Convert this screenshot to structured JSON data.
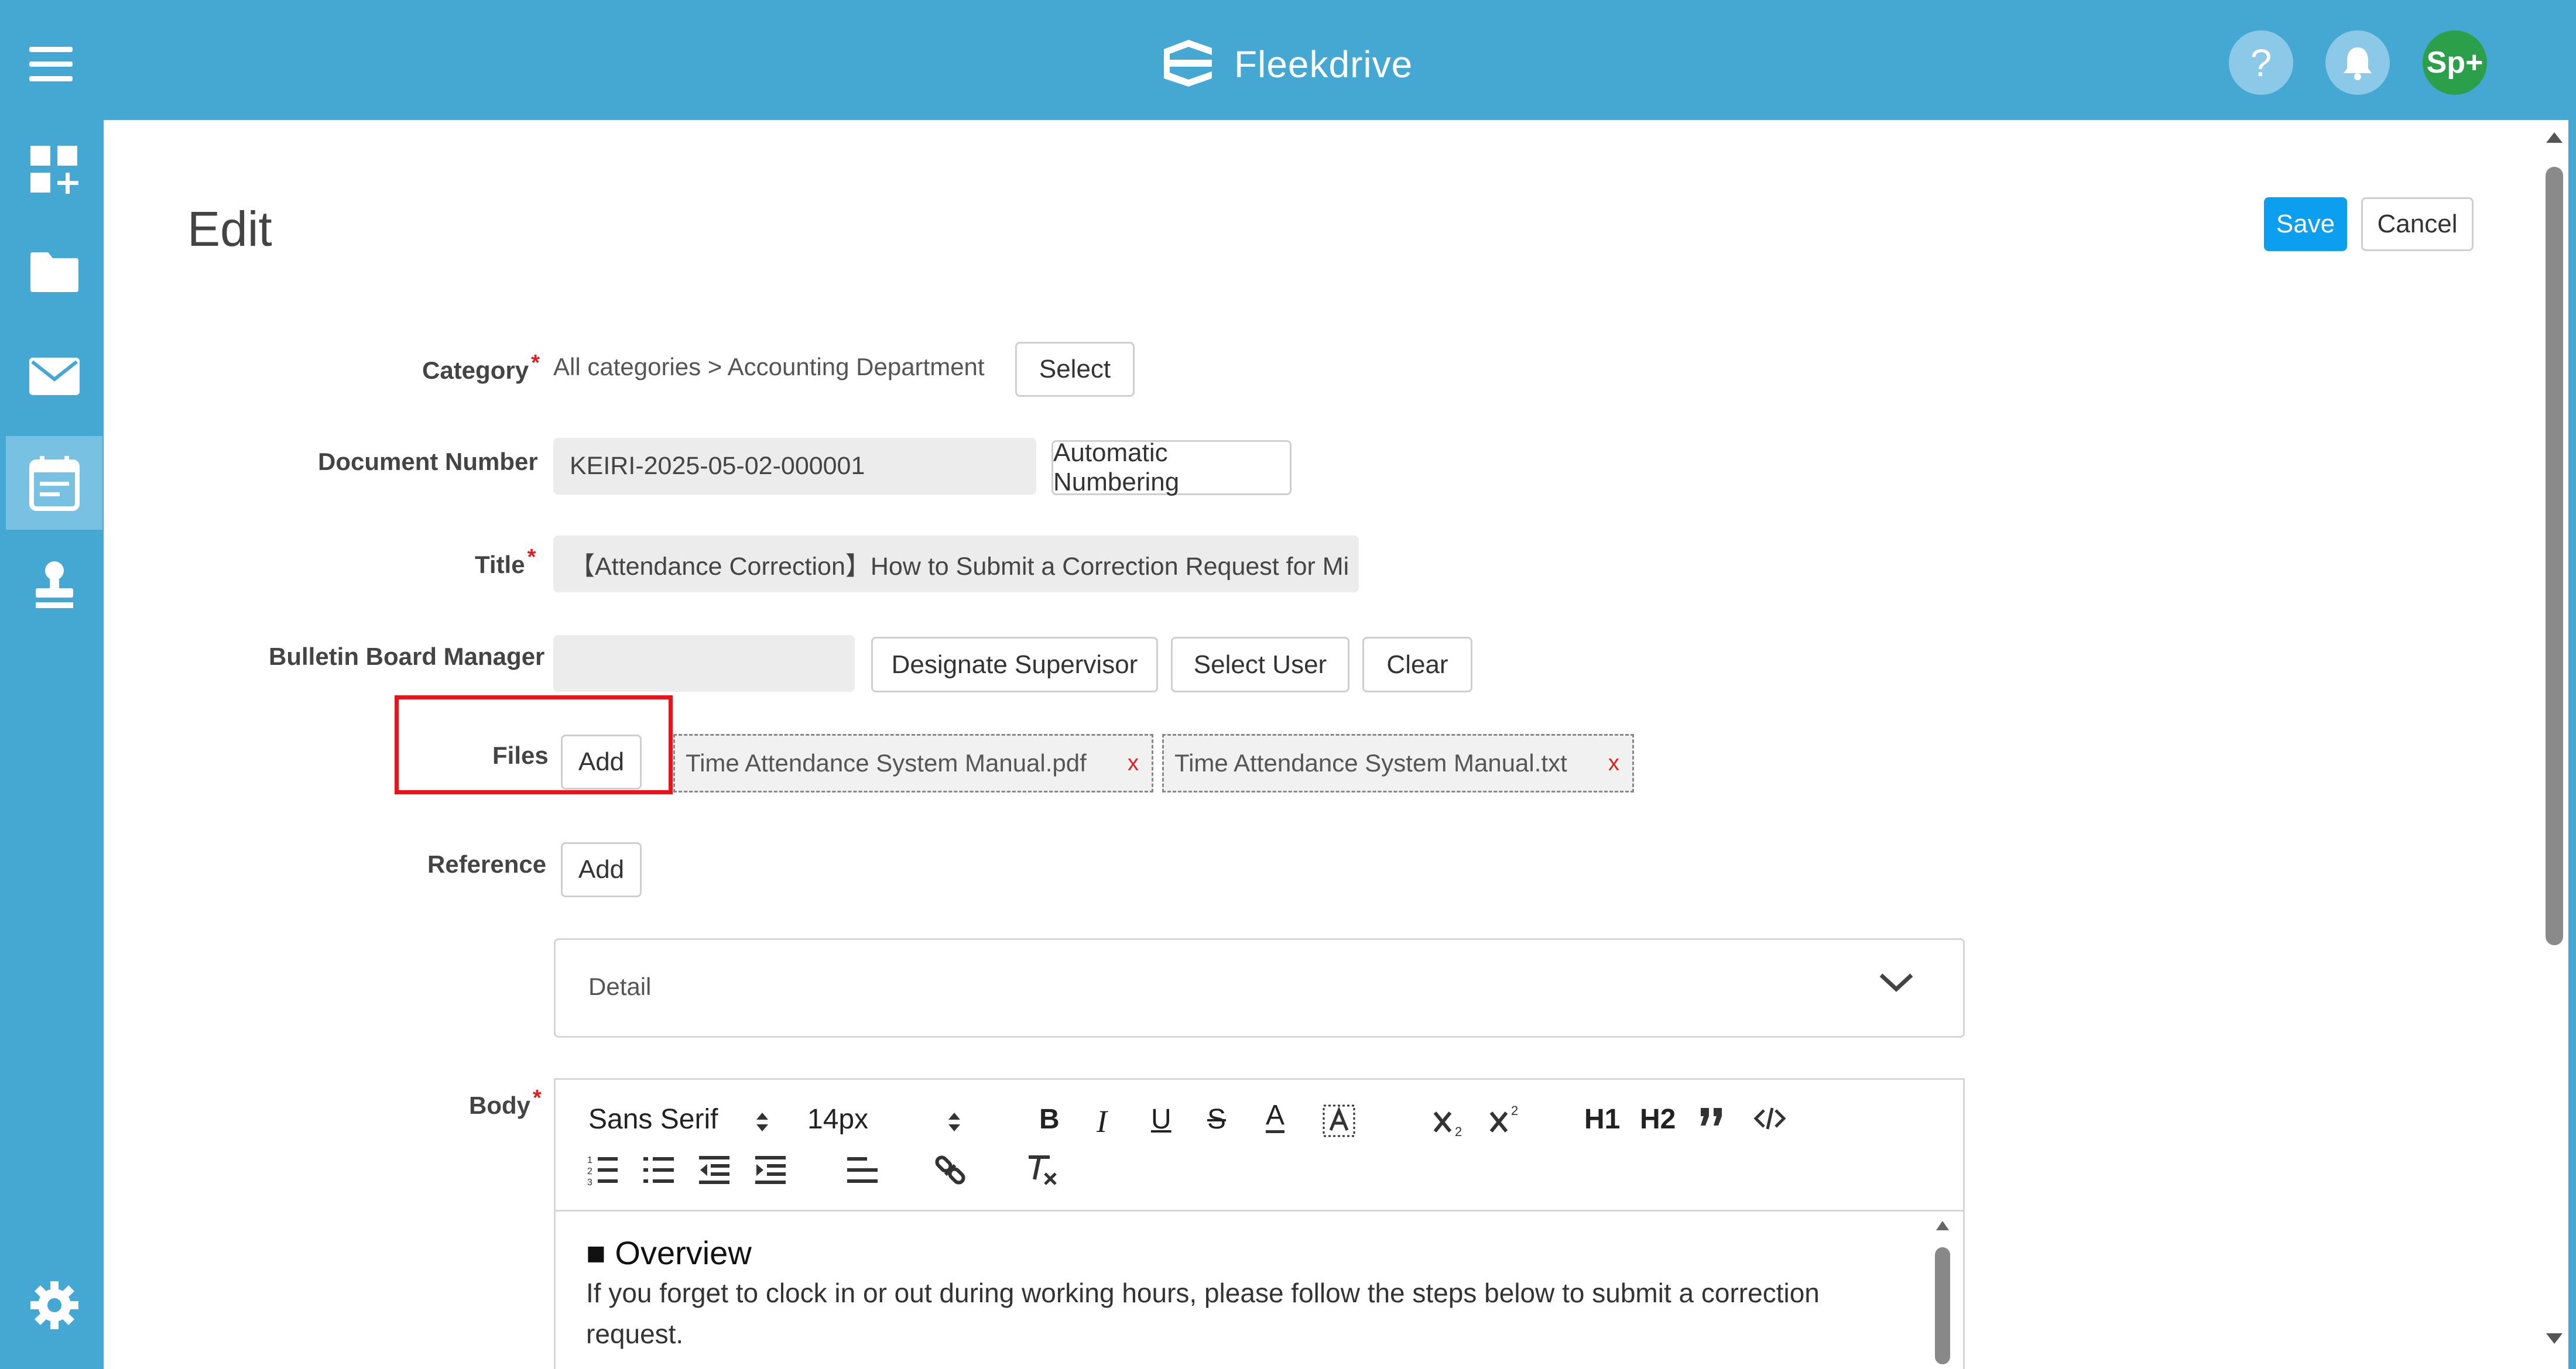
{
  "header": {
    "logo_text": "Fleekdrive",
    "help_label": "?",
    "avatar_label": "Sp+"
  },
  "sidebar": {
    "items": [
      {
        "icon": "dashboard-add-icon"
      },
      {
        "icon": "folder-icon"
      },
      {
        "icon": "mail-icon"
      },
      {
        "icon": "calendar-board-icon",
        "active": true
      },
      {
        "icon": "stamp-icon"
      }
    ],
    "bottom_icon": "gear-icon"
  },
  "page": {
    "title": "Edit",
    "save_label": "Save",
    "cancel_label": "Cancel"
  },
  "form": {
    "category": {
      "label": "Category",
      "required_mark": "*",
      "value": "All categories > Accounting Department",
      "button": "Select"
    },
    "document_number": {
      "label": "Document Number",
      "value": "KEIRI-2025-05-02-000001",
      "button": "Automatic Numbering"
    },
    "title": {
      "label": "Title",
      "required_mark": "*",
      "value": "【Attendance Correction】How to Submit a Correction Request for Mi"
    },
    "bulletin_manager": {
      "label": "Bulletin Board Manager",
      "value": "",
      "buttons": [
        "Designate Supervisor",
        "Select User",
        "Clear"
      ]
    },
    "files": {
      "label": "Files",
      "add_button": "Add",
      "items": [
        "Time Attendance System Manual.pdf",
        "Time Attendance System Manual.txt"
      ],
      "remove_glyph": "x"
    },
    "reference": {
      "label": "Reference",
      "add_button": "Add"
    },
    "detail": {
      "label": "Detail"
    },
    "body": {
      "label": "Body",
      "required_mark": "*",
      "toolbar": {
        "font": "Sans Serif",
        "size": "14px",
        "bold": "B",
        "italic": "I",
        "underline": "U",
        "strike": "S",
        "text_color": "A",
        "h1": "H1",
        "h2": "H2"
      },
      "content": {
        "heading": "■ Overview",
        "paragraph": "If you forget to clock in or out during working hours, please follow the steps below to submit a correction request."
      }
    }
  },
  "colors": {
    "brand": "#44a8d3",
    "save": "#0c9ff0",
    "highlight": "#e8141c",
    "required": "#e02020",
    "avatar": "#2c9f4a"
  }
}
